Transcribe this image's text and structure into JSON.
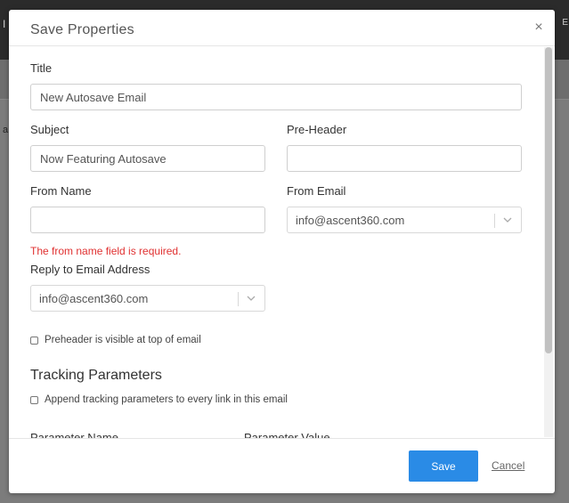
{
  "background": {
    "left_glyph": "I",
    "left_glyph2": "a",
    "right_glyph": "E"
  },
  "modal": {
    "title": "Save Properties",
    "close_glyph": "×",
    "fields": {
      "title_label": "Title",
      "title_value": "New Autosave Email",
      "subject_label": "Subject",
      "subject_value": "Now Featuring Autosave",
      "preheader_label": "Pre-Header",
      "preheader_value": "",
      "from_name_label": "From Name",
      "from_name_value": "",
      "from_name_error": "The from name field is required.",
      "from_email_label": "From Email",
      "from_email_value": "info@ascent360.com",
      "reply_to_label": "Reply to Email Address",
      "reply_to_value": "info@ascent360.com"
    },
    "preheader_visible_label": "Preheader is visible at top of email",
    "preheader_visible_checked": false,
    "tracking": {
      "title": "Tracking Parameters",
      "append_label": "Append tracking parameters to every link in this email",
      "append_checked": false,
      "columns": [
        "Parameter Name",
        "Parameter Value"
      ]
    },
    "footer": {
      "save_label": "Save",
      "cancel_label": "Cancel"
    }
  },
  "colors": {
    "primary": "#2a8be6",
    "error": "#e03131",
    "overlay": "#7c7c7c"
  }
}
